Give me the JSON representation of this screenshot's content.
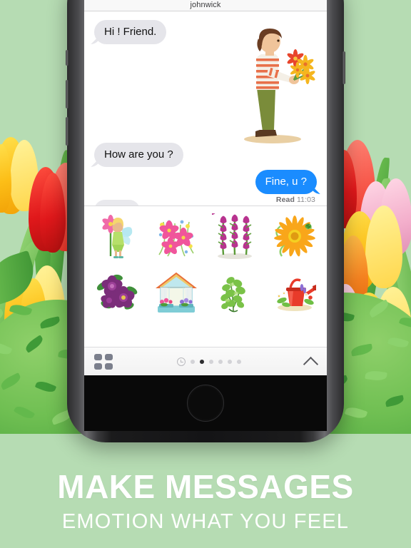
{
  "background": {
    "color": "#b6dcb3",
    "scene": "spring tulips and green bushes"
  },
  "phone": {
    "frame_color": "#141416",
    "home_button_label": "home-button"
  },
  "messaging_app": {
    "nav": {
      "contact_name": "johnwick"
    },
    "messages": [
      {
        "id": "hi",
        "text": "Hi ! Friend.",
        "side": "incoming"
      },
      {
        "id": "how",
        "text": "How are you ?",
        "side": "incoming"
      },
      {
        "id": "fine",
        "text": "Fine, u ?",
        "side": "outgoing"
      }
    ],
    "receipt": {
      "status": "Read",
      "time": "11:03"
    },
    "typing_indicator": "typing-indicator",
    "illustration": "boy-holding-flower-bouquet",
    "colors": {
      "incoming_bubble": "#e5e5ea",
      "outgoing_bubble": "#1a8cff",
      "incoming_text": "#111111",
      "outgoing_text": "#ffffff",
      "receipt_text": "#8a8a8e"
    }
  },
  "sticker_panel": {
    "stickers": [
      {
        "name": "fairy-with-pink-flower"
      },
      {
        "name": "pink-flowers-bouquet"
      },
      {
        "name": "purple-tulip-rows"
      },
      {
        "name": "yellow-sunflower-with-ladybug"
      },
      {
        "name": "purple-peonies"
      },
      {
        "name": "window-flower-box"
      },
      {
        "name": "green-bush"
      },
      {
        "name": "red-watering-can-with-flowers"
      }
    ],
    "toolbar": {
      "grid_icon": "sticker-grid-icon",
      "recents_icon": "clock-icon",
      "collapse_icon": "chevron-up-icon",
      "page_count": 6,
      "active_page": 2
    }
  },
  "marketing": {
    "headline": "MAKE MESSAGES",
    "subhead": "EMOTION WHAT YOU FEEL",
    "text_color": "#ffffff"
  }
}
